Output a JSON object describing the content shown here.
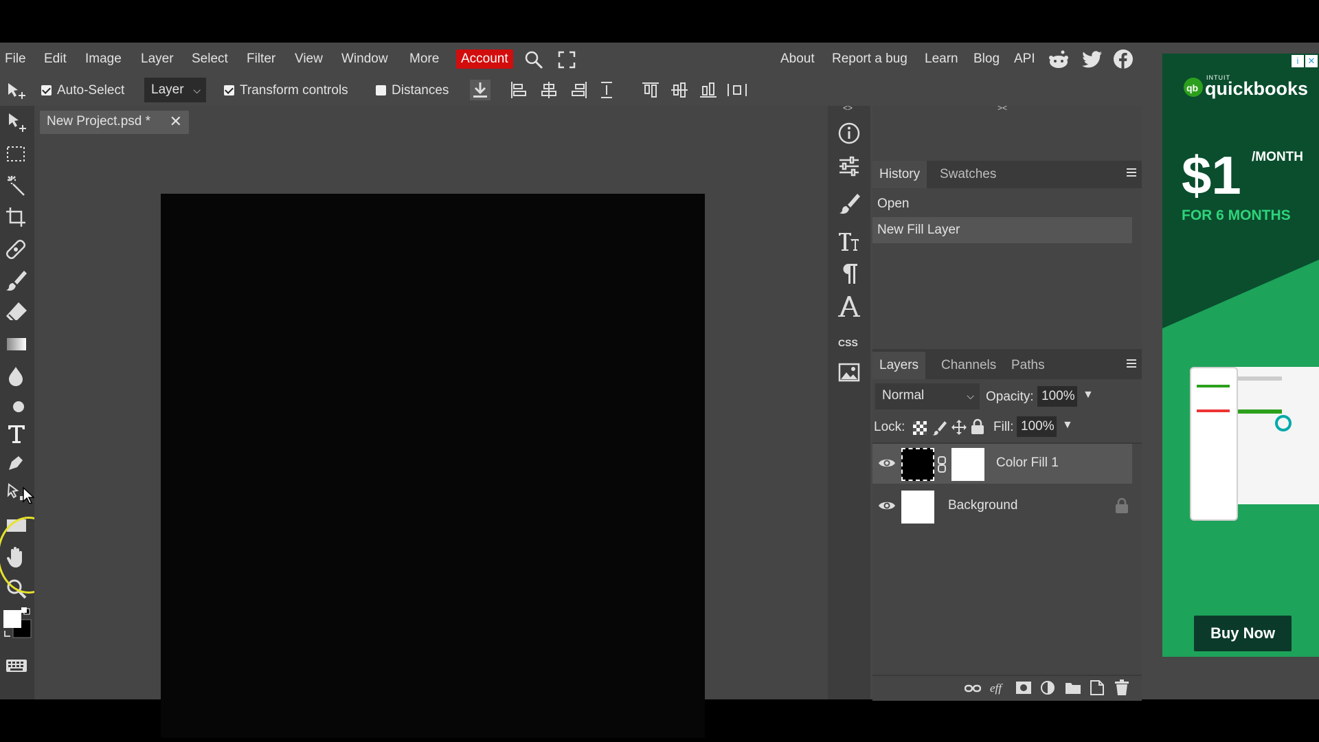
{
  "menu": {
    "items": [
      "File",
      "Edit",
      "Image",
      "Layer",
      "Select",
      "Filter",
      "View",
      "Window",
      "More"
    ],
    "account": "Account",
    "right_items": [
      "About",
      "Report a bug",
      "Learn",
      "Blog",
      "API"
    ],
    "icons": [
      "search-icon",
      "fullscreen-icon",
      "reddit-icon",
      "twitter-icon",
      "facebook-icon"
    ]
  },
  "options": {
    "auto_select_label": "Auto-Select",
    "auto_select_checked": true,
    "layer_select": "Layer",
    "transform_label": "Transform controls",
    "transform_checked": true,
    "distances_label": "Distances",
    "distances_checked": false
  },
  "document": {
    "tab_title": "New Project.psd *",
    "close_symbol": "✕",
    "canvas_color": "#060606"
  },
  "history": {
    "tabs": [
      "History",
      "Swatches"
    ],
    "items": [
      "Open",
      "New Fill Layer"
    ]
  },
  "layers": {
    "tabs": [
      "Layers",
      "Channels",
      "Paths"
    ],
    "blend_mode": "Normal",
    "opacity_label": "Opacity:",
    "opacity_value": "100%",
    "lock_label": "Lock:",
    "fill_label": "Fill:",
    "fill_value": "100%",
    "items": [
      {
        "name": "Color Fill 1",
        "visible": true
      },
      {
        "name": "Background",
        "visible": true,
        "locked": true
      }
    ]
  },
  "midcol": {
    "css_label": "CSS"
  },
  "ad": {
    "intuit": "INTUIT",
    "brand": "quickbooks",
    "price": "$1",
    "per": "/MONTH",
    "promo": "FOR 6 MONTHS",
    "cta": "Buy Now"
  },
  "colors": {
    "panel_bg": "#474747",
    "toolbar_bg": "#3a3a3a",
    "account_red": "#d20d0d",
    "ad_green": "#1ea35a"
  }
}
